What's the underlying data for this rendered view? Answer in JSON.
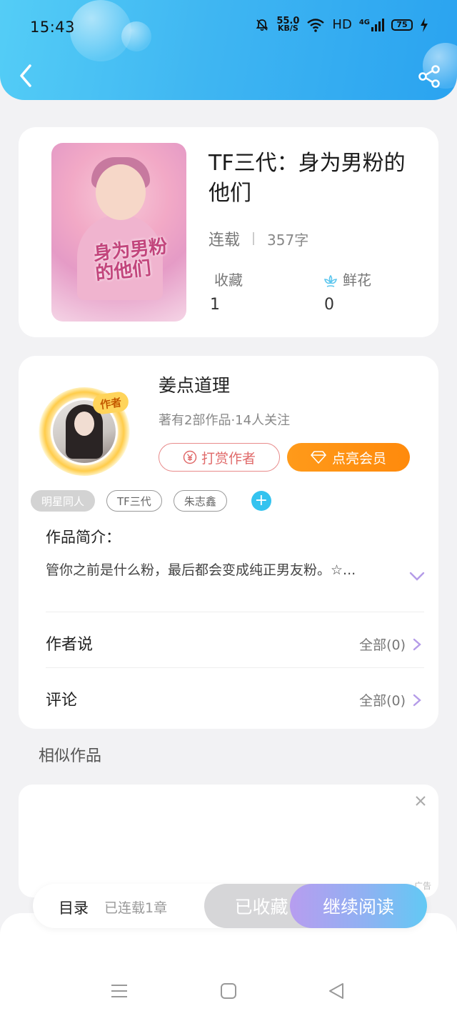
{
  "status_bar": {
    "time": "15:43",
    "net_speed_value": "55.0",
    "net_speed_unit": "KB/S",
    "hd_label": "HD",
    "network_label": "4G",
    "battery": "75"
  },
  "book": {
    "title": "TF三代：身为男粉的他们",
    "cover_text": "身为男粉的他们",
    "status": "连载",
    "word_count": "357字",
    "favorites_label": "收藏",
    "favorites_count": "1",
    "flowers_label": "鲜花",
    "flowers_count": "0"
  },
  "author": {
    "badge": "作者",
    "name": "姜点道理",
    "info": "著有2部作品·14人关注",
    "tip_label": "打赏作者",
    "vip_label": "点亮会员"
  },
  "tags": [
    "明星同人",
    "TF三代",
    "朱志鑫"
  ],
  "intro": {
    "label": "作品简介：",
    "text": "管你之前是什么粉，最后都会变成纯正男友粉。☆..."
  },
  "author_says": {
    "label": "作者说",
    "right": "全部(0)"
  },
  "comments": {
    "label": "评论",
    "right": "全部(0)"
  },
  "similar": {
    "title": "相似作品"
  },
  "ad": {
    "tag": "广告"
  },
  "bottom_bar": {
    "toc_label": "目录",
    "chapters_label": "已连载1章",
    "favorited_label": "已收藏",
    "continue_label": "继续阅读"
  },
  "colors": {
    "header_start": "#54cdf6",
    "header_end": "#2aa3f0",
    "accent_orange": "#ff8a0c",
    "tip_red": "#e06a6a",
    "tag_add_blue": "#34c3ef",
    "chevron_purple": "#b49be8"
  }
}
